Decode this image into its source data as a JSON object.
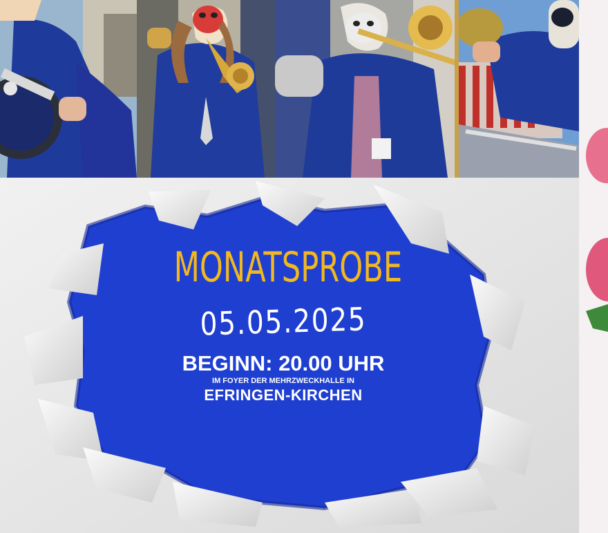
{
  "poster": {
    "title": "MONATSPROBE",
    "date": "05.05.2025",
    "begin": "BEGINN: 20.00 UHR",
    "venue": "IM FOYER DER MEHRZWECKHALLE IN",
    "town": "EFRINGEN-KIRCHEN"
  },
  "colors": {
    "title": "#f2b81f",
    "hole_blue": "#1f3fd1",
    "costume_blue": "#1d3a9c",
    "paper": "#e9e9e9"
  },
  "photos": [
    {
      "name": "photo-drummer"
    },
    {
      "name": "photo-trumpeter"
    },
    {
      "name": "photo-trombonist"
    },
    {
      "name": "photo-cymbal-player"
    }
  ]
}
